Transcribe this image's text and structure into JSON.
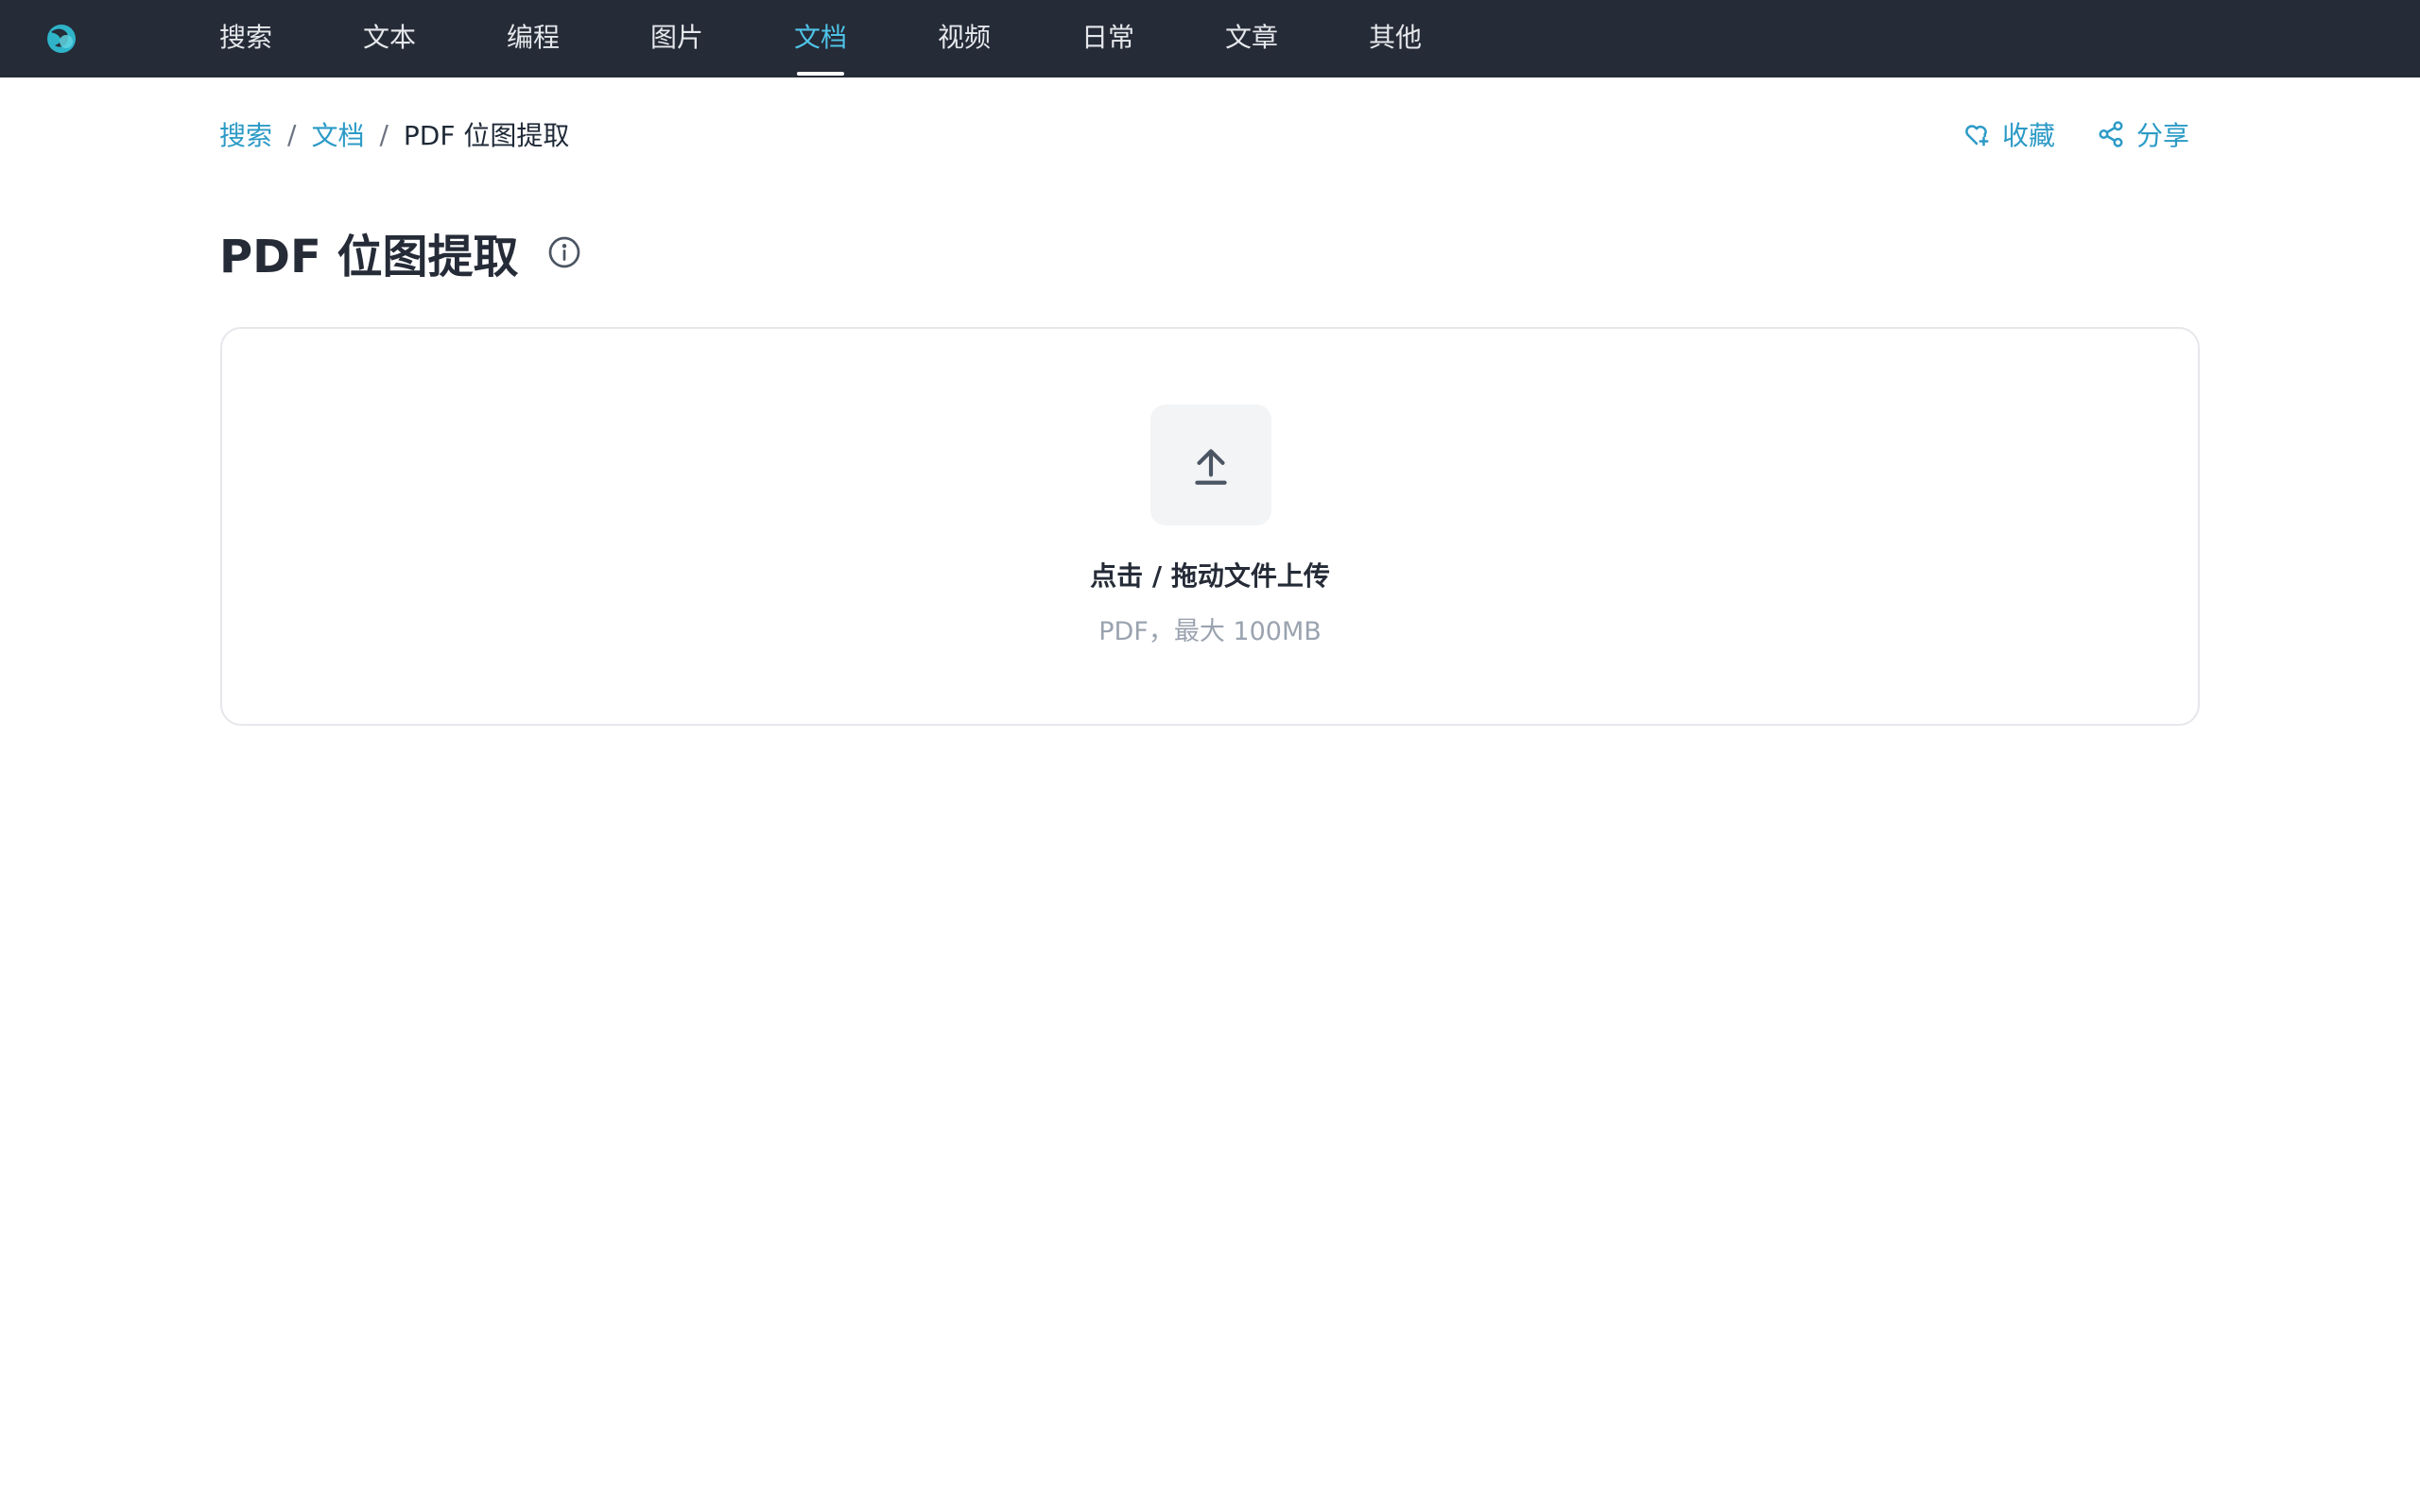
{
  "nav": {
    "items": [
      {
        "label": "搜索"
      },
      {
        "label": "文本"
      },
      {
        "label": "编程"
      },
      {
        "label": "图片"
      },
      {
        "label": "文档"
      },
      {
        "label": "视频"
      },
      {
        "label": "日常"
      },
      {
        "label": "文章"
      },
      {
        "label": "其他"
      }
    ],
    "active": "文档"
  },
  "breadcrumb": {
    "items": [
      "搜索",
      "文档"
    ],
    "separator": "/",
    "current": "PDF 位图提取"
  },
  "actions": {
    "favorite_label": "收藏",
    "favorite_icon": "heart-plus-icon",
    "share_label": "分享",
    "share_icon": "share-icon"
  },
  "page": {
    "title": "PDF 位图提取",
    "info_icon": "info-circle-icon"
  },
  "upload": {
    "icon": "upload-arrow-icon",
    "title": "点击 / 拖动文件上传",
    "hint": "PDF，最大 100MB"
  },
  "colors": {
    "topbar": "#252b37",
    "accent": "#2b9ac6",
    "nav_active": "#4fc3e8"
  }
}
